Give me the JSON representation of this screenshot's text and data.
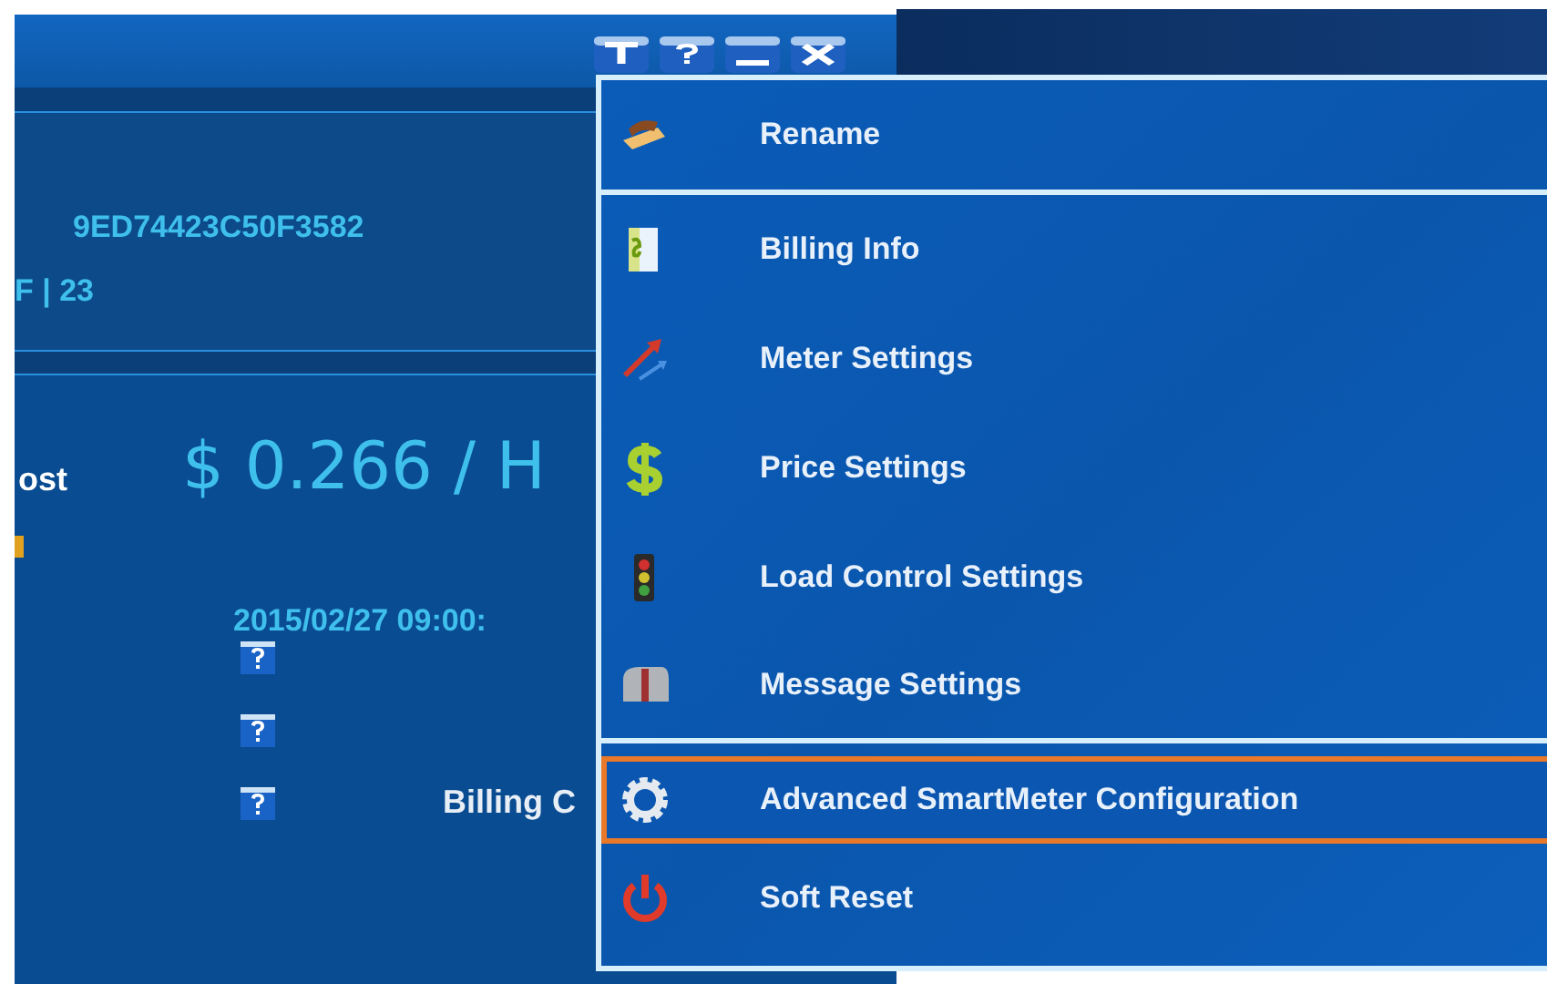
{
  "device": {
    "id": "9ED74423C50F3582",
    "info": "F | 23"
  },
  "cost": {
    "label": "ost",
    "value": "$ 0.266 / H"
  },
  "timestamp": "2015/02/27 09:00:",
  "billing_label": "Billing C",
  "menu": {
    "groups": [
      [
        {
          "label": "Rename",
          "selected": false
        }
      ],
      [
        {
          "label": "Billing Info",
          "selected": false
        },
        {
          "label": "Meter Settings",
          "selected": false
        },
        {
          "label": "Price Settings",
          "selected": false
        },
        {
          "label": "Load Control Settings",
          "selected": false
        },
        {
          "label": "Message Settings",
          "selected": false
        }
      ],
      [
        {
          "label": "Advanced SmartMeter Configuration",
          "selected": true
        },
        {
          "label": "Soft Reset",
          "selected": false
        }
      ]
    ]
  }
}
